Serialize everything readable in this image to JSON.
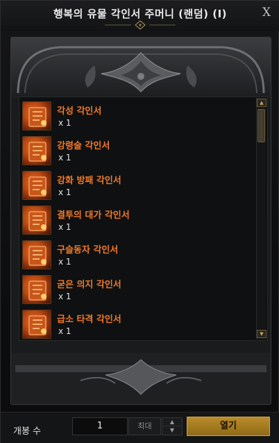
{
  "window": {
    "title": "행복의 유물 각인서 주머니 (랜덤) (I)",
    "close_label": "X"
  },
  "items": [
    {
      "name": "각성 각인서",
      "qty": "x 1",
      "icon": "engraving-book-icon"
    },
    {
      "name": "강령술 각인서",
      "qty": "x 1",
      "icon": "engraving-book-icon"
    },
    {
      "name": "강화 방패 각인서",
      "qty": "x 1",
      "icon": "engraving-book-icon"
    },
    {
      "name": "결투의 대가 각인서",
      "qty": "x 1",
      "icon": "engraving-book-icon"
    },
    {
      "name": "구슬동자 각인서",
      "qty": "x 1",
      "icon": "engraving-book-icon"
    },
    {
      "name": "굳은 의지 각인서",
      "qty": "x 1",
      "icon": "engraving-book-icon"
    },
    {
      "name": "급소 타격 각인서",
      "qty": "x 1",
      "icon": "engraving-book-icon"
    }
  ],
  "footer": {
    "open_count_label": "개봉 수",
    "quantity_value": "1",
    "max_label": "최대",
    "open_button_label": "열기"
  },
  "colors": {
    "item_name": "#f07a2a",
    "accent_gold": "#b98c2a",
    "background": "#0b0b0c"
  }
}
